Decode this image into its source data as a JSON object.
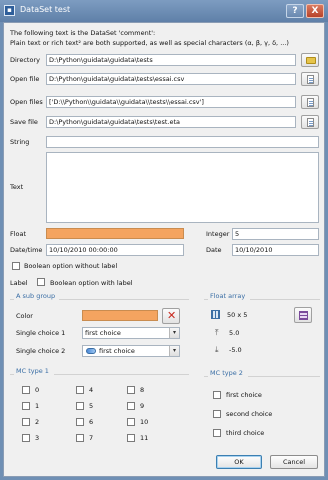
{
  "window": {
    "title": "DataSet test",
    "help_glyph": "?",
    "close_glyph": "X"
  },
  "comment": {
    "line1": "The following text is the DataSet 'comment':",
    "line2": "Plain text or rich text² are both supported, as well as special characters (α, β, γ, δ, ...)"
  },
  "fields": {
    "directory": {
      "label": "Directory",
      "value": "D:\\Python\\guidata\\guidata\\tests"
    },
    "open_file": {
      "label": "Open file",
      "value": "D:\\Python\\guidata\\guidata\\tests\\essai.csv"
    },
    "open_files": {
      "label": "Open files",
      "value": "['D:\\\\Python\\\\guidata\\\\guidata\\\\tests\\\\essai.csv']"
    },
    "save_file": {
      "label": "Save file",
      "value": "D:\\Python\\guidata\\guidata\\tests\\test.eta"
    },
    "string": {
      "label": "String",
      "value": ""
    },
    "text": {
      "label": "Text",
      "value": ""
    },
    "float": {
      "label": "Float"
    },
    "integer": {
      "label": "Integer",
      "value": "5"
    },
    "datetime": {
      "label": "Date/time",
      "value": "10/10/2010 00:00:00"
    },
    "date": {
      "label": "Date",
      "value": "10/10/2010"
    },
    "bool_no_label": {
      "label": "Boolean option without label"
    },
    "bool_label_left": "Label",
    "bool_with_label": {
      "label": "Boolean option with label"
    }
  },
  "subgroup": {
    "title": "A sub group",
    "color_label": "Color",
    "color_value": "#f4a460",
    "single_choice_1": {
      "label": "Single choice 1",
      "value": "first choice"
    },
    "single_choice_2": {
      "label": "Single choice 2",
      "value": "first choice"
    }
  },
  "float_array": {
    "title": "Float array",
    "size": "50 x 5",
    "max": "5.0",
    "min": "-5.0"
  },
  "mc_type_1": {
    "title": "MC type 1",
    "options": [
      "0",
      "1",
      "2",
      "3",
      "4",
      "5",
      "6",
      "7",
      "8",
      "9",
      "10",
      "11"
    ]
  },
  "mc_type_2": {
    "title": "MC type 2",
    "options": [
      "first choice",
      "second choice",
      "third choice"
    ]
  },
  "buttons": {
    "ok": "OK",
    "cancel": "Cancel"
  },
  "colors": {
    "float_field": "#f4a460",
    "accent": "#3a6ea5"
  },
  "icons": {
    "directory_button": "folder-open-icon",
    "file_buttons": "document-icon",
    "color_clear": "red-x-icon",
    "float_array_edit": "table-edit-icon"
  }
}
